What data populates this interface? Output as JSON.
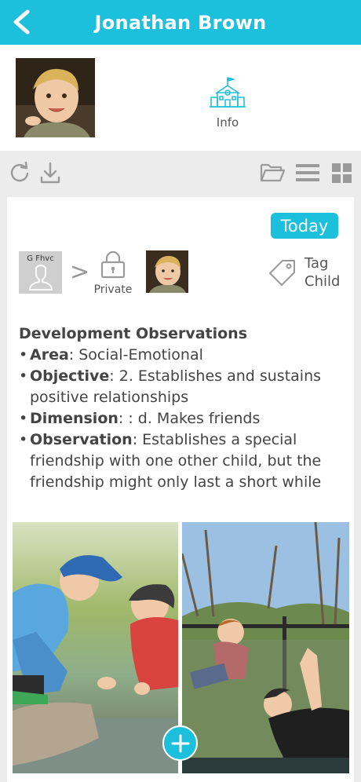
{
  "header": {
    "title": "Jonathan Brown"
  },
  "profile": {
    "info_label": "Info"
  },
  "toolbar": {
    "icons": [
      "refresh-icon",
      "download-icon",
      "folder-icon",
      "list-view-icon",
      "grid-view-icon"
    ]
  },
  "post": {
    "date_badge": "Today",
    "from_name": "G Fhvc",
    "privacy_label": "Private",
    "tag_label_line1": "Tag",
    "tag_label_line2": "Child",
    "observation": {
      "title": "Development Observations",
      "items": [
        {
          "key": "Area",
          "sep": ": ",
          "value": "Social-Emotional"
        },
        {
          "key": "Objective",
          "sep": ": ",
          "value": "2. Establishes and sustains positive relationships"
        },
        {
          "key": "Dimension",
          "sep": ": : ",
          "value": "d. Makes friends"
        },
        {
          "key": "Observation",
          "sep": ": ",
          "value": "Establishes a special friendship with one other child, but the friendship might only last a short while"
        }
      ]
    }
  },
  "colors": {
    "accent": "#1cc0dd",
    "background": "#ececec",
    "icon_gray": "#9a9a9a"
  }
}
